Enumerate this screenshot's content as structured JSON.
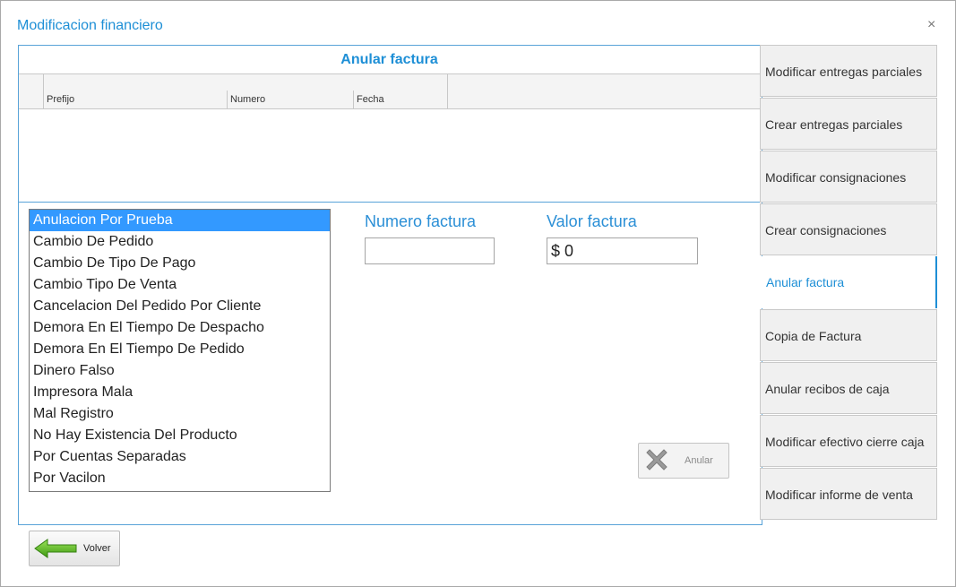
{
  "window": {
    "title": "Modificacion financiero",
    "close": "×"
  },
  "grid": {
    "title": "Anular factura",
    "columns": [
      "Prefijo",
      "Numero",
      "Fecha"
    ]
  },
  "reasons": {
    "selected_index": 0,
    "items": [
      "Anulacion Por Prueba",
      "Cambio De Pedido",
      "Cambio De Tipo De Pago",
      "Cambio Tipo De Venta",
      "Cancelacion Del Pedido Por Cliente",
      "Demora En El Tiempo De Despacho",
      "Demora En El Tiempo De Pedido",
      "Dinero Falso",
      "Impresora Mala",
      "Mal Registro",
      "No Hay Existencia Del Producto",
      "Por Cuentas Separadas",
      "Por Vacilon"
    ]
  },
  "form": {
    "numero_label": "Numero factura",
    "numero_value": "",
    "valor_label": "Valor factura",
    "valor_value": "$ 0"
  },
  "buttons": {
    "anular": "Anular",
    "volver": "Volver"
  },
  "tabs": [
    {
      "label": "Modificar entregas parciales",
      "active": false
    },
    {
      "label": "Crear entregas parciales",
      "active": false
    },
    {
      "label": "Modificar consignaciones",
      "active": false
    },
    {
      "label": "Crear consignaciones",
      "active": false
    },
    {
      "label": "Anular factura",
      "active": true
    },
    {
      "label": "Copia de Factura",
      "active": false
    },
    {
      "label": "Anular recibos de caja",
      "active": false
    },
    {
      "label": "Modificar efectivo cierre caja",
      "active": false
    },
    {
      "label": "Modificar informe de venta",
      "active": false
    }
  ],
  "colors": {
    "accent": "#1e8fd6",
    "selection": "#3399ff",
    "icon_x": "#9a9a9a",
    "arrow": "#4caf1e"
  }
}
